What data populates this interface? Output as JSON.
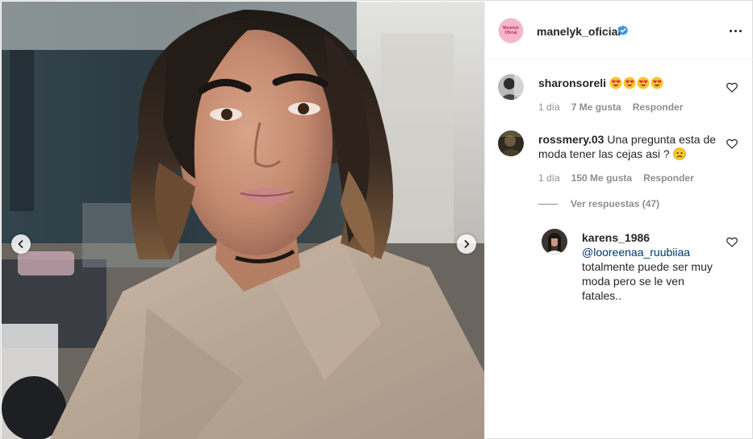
{
  "post": {
    "account_username": "manelyk_oficial",
    "avatar_text": "Manelyk Oficial",
    "verified_icon": "verified-badge-icon",
    "more_icon": "more-options-icon"
  },
  "carousel": {
    "prev_icon": "chevron-left-icon",
    "next_icon": "chevron-right-icon"
  },
  "comments": [
    {
      "username": "sharonsoreli",
      "text": "",
      "emojis": [
        "heart-eyes-emoji",
        "heart-eyes-emoji",
        "heart-eyes-emoji",
        "heart-eyes-emoji"
      ],
      "time": "1 día",
      "likes": "7 Me gusta",
      "reply_label": "Responder"
    },
    {
      "username": "rossmery.03",
      "text": "Una pregunta esta de moda tener las cejas asi ?",
      "emojis": [
        "worried-face-emoji"
      ],
      "time": "1 día",
      "likes": "150 Me gusta",
      "reply_label": "Responder",
      "view_replies": "Ver respuestas (47)"
    }
  ],
  "reply": {
    "username": "karens_1986",
    "mention": "@looreenaa_ruubiiaa",
    "text": "totalmente puede ser muy moda pero se le ven fatales.."
  },
  "colors": {
    "link": "#00376b",
    "meta_gray": "#8e8e8e",
    "verified_blue": "#3897f0",
    "border": "#dbdbdb"
  }
}
